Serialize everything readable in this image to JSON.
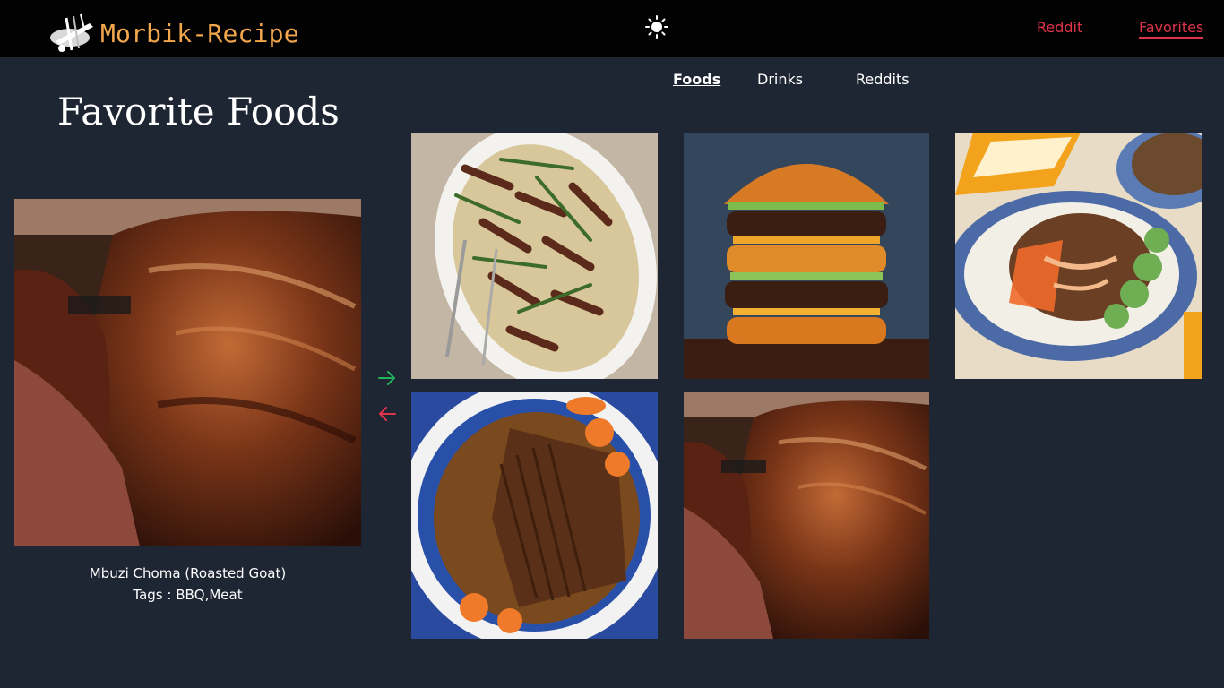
{
  "brand": {
    "name": "Morbik-Recipe",
    "logo_icon": "chef-knife-fork-logo"
  },
  "nav": {
    "theme_icon": "sun-icon",
    "reddit": "Reddit",
    "favorites": "Favorites"
  },
  "tabs": {
    "foods": "Foods",
    "drinks": "Drinks",
    "reddits": "Reddits",
    "active": "Foods"
  },
  "page": {
    "title": "Favorite Foods"
  },
  "featured": {
    "name": "Mbuzi Choma (Roasted Goat)",
    "tags": "Tags : BBQ,Meat"
  },
  "arrows": {
    "next_icon": "arrow-right-icon",
    "prev_icon": "arrow-left-icon",
    "next_color": "#22b35a",
    "prev_color": "#e0344b"
  },
  "grid": [
    {
      "image": "beef-asparagus-noodles-photo"
    },
    {
      "image": "double-cheeseburger-photo"
    },
    {
      "image": "ground-beef-rice-bowl-photo"
    },
    {
      "image": "braised-brisket-carrots-photo"
    },
    {
      "image": "roasted-goat-photo"
    }
  ],
  "colors": {
    "accent": "#e0344b",
    "brand": "#f2a74d",
    "background": "#1e2533",
    "topbar": "#020202"
  }
}
